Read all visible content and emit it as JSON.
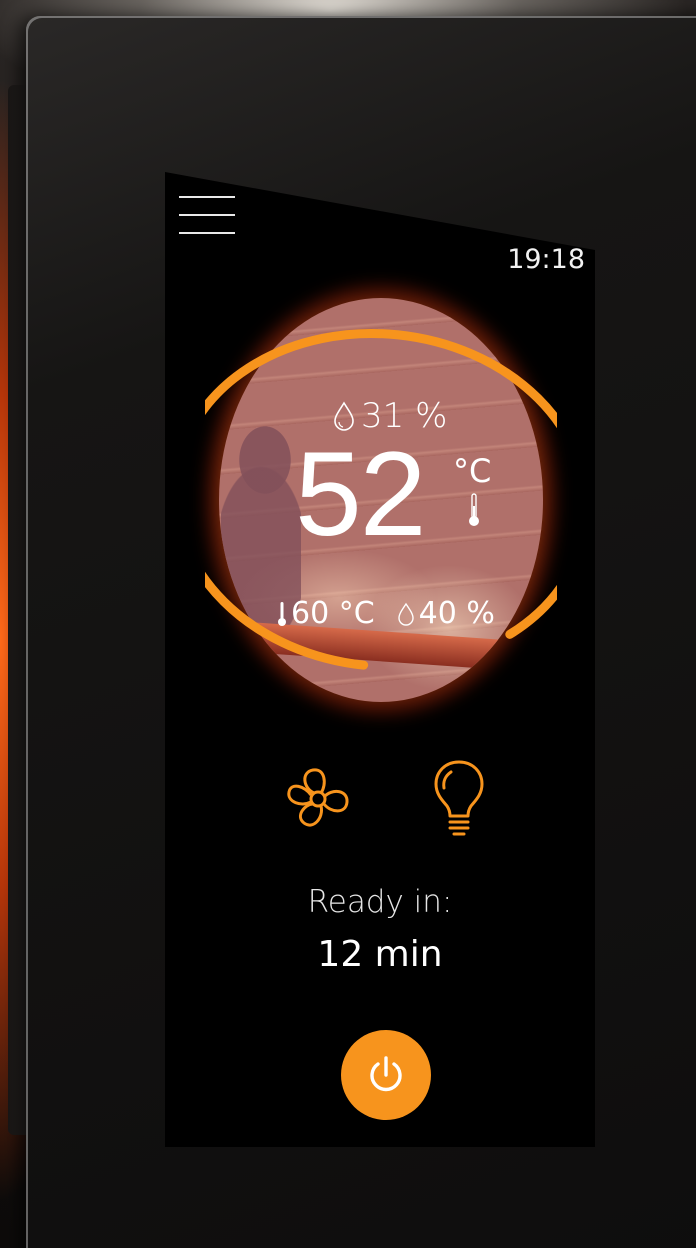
{
  "clock": {
    "time": "19:18"
  },
  "dial": {
    "humidity_current": "31 %",
    "temperature_current": "52",
    "temperature_unit": "°C",
    "setpoint_temperature": "60 °C",
    "setpoint_humidity": "40 %",
    "progress_fraction": 0.87
  },
  "controls": {
    "fan_icon": "fan-icon",
    "light_icon": "light-bulb-icon"
  },
  "status": {
    "ready_label": "Ready in:",
    "ready_value": "12 min"
  },
  "power": {
    "icon": "power-icon"
  },
  "colors": {
    "accent": "#f7941d",
    "glow": "#ff6a1a",
    "background": "#000000",
    "text": "#ffffff"
  }
}
